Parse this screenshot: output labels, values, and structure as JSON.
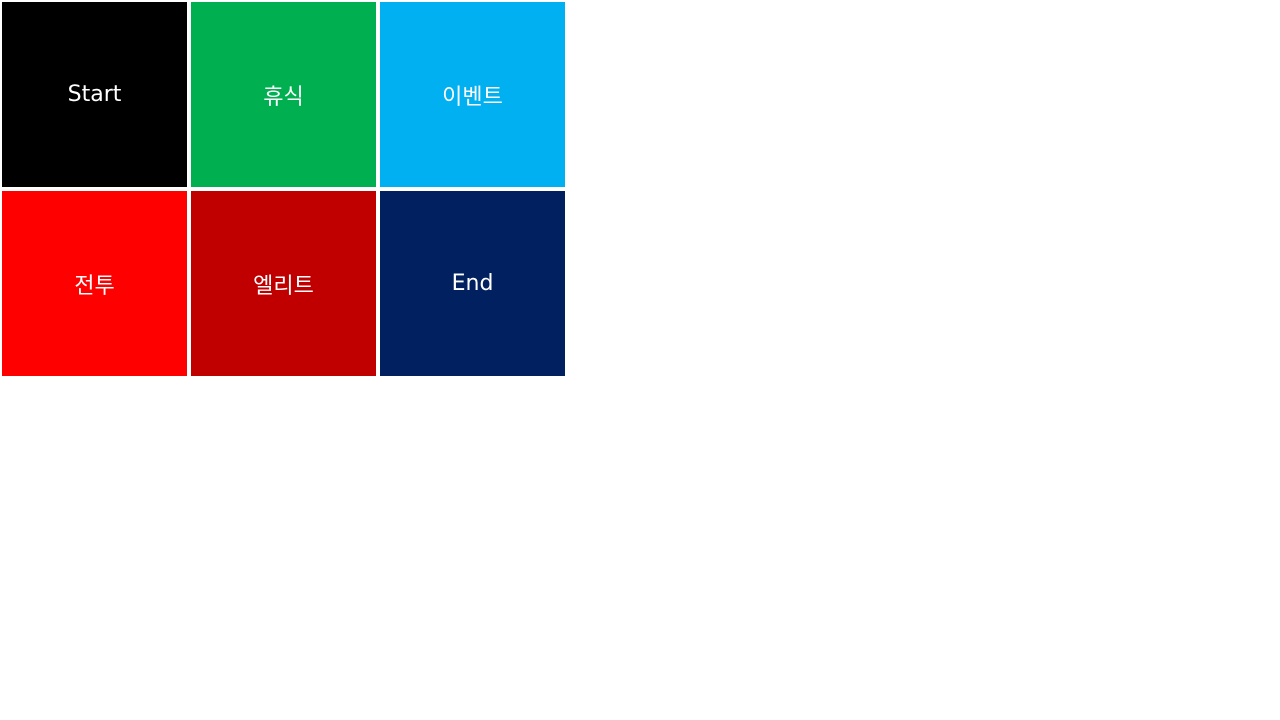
{
  "tiles": [
    {
      "id": "start",
      "label": "Start",
      "color": "#000000"
    },
    {
      "id": "rest",
      "label": "휴식",
      "color": "#00B050"
    },
    {
      "id": "event",
      "label": "이벤트",
      "color": "#00B0F0"
    },
    {
      "id": "battle",
      "label": "전투",
      "color": "#FF0000"
    },
    {
      "id": "elite",
      "label": "엘리트",
      "color": "#C00000"
    },
    {
      "id": "end",
      "label": "End",
      "color": "#002060"
    }
  ]
}
